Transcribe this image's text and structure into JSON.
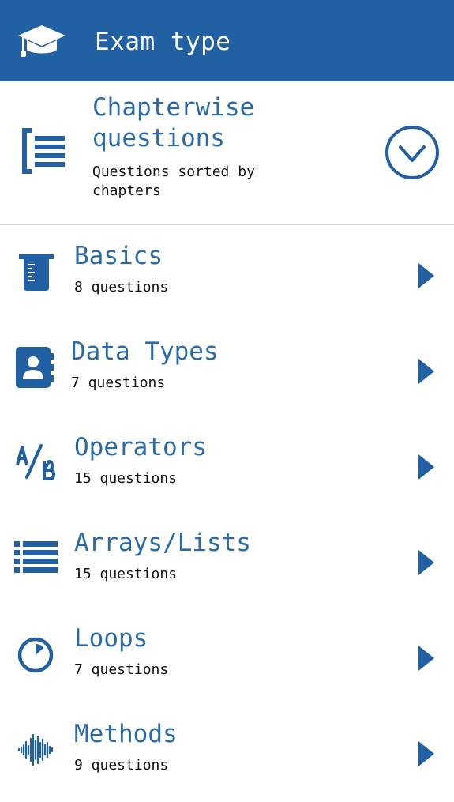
{
  "colors": {
    "primary": "#2160a2",
    "accent": "#2a6aa8",
    "text": "#111111"
  },
  "appbar": {
    "title": "Exam type",
    "icon": "graduation-cap-icon"
  },
  "selector": {
    "title": "Chapterwise questions",
    "subtitle": "Questions sorted by chapters",
    "icon": "list-bracket-icon",
    "expand_icon": "chevron-down-circle-icon"
  },
  "chapters": [
    {
      "title": "Basics",
      "count": "8 questions",
      "icon": "beaker-icon"
    },
    {
      "title": "Data Types",
      "count": "7 questions",
      "icon": "contact-book-icon"
    },
    {
      "title": "Operators",
      "count": "15 questions",
      "icon": "a-slash-b-icon"
    },
    {
      "title": "Arrays/Lists",
      "count": "15 questions",
      "icon": "bulleted-list-icon"
    },
    {
      "title": "Loops",
      "count": "7 questions",
      "icon": "timer-icon"
    },
    {
      "title": "Methods",
      "count": "9 questions",
      "icon": "waveform-icon"
    }
  ]
}
